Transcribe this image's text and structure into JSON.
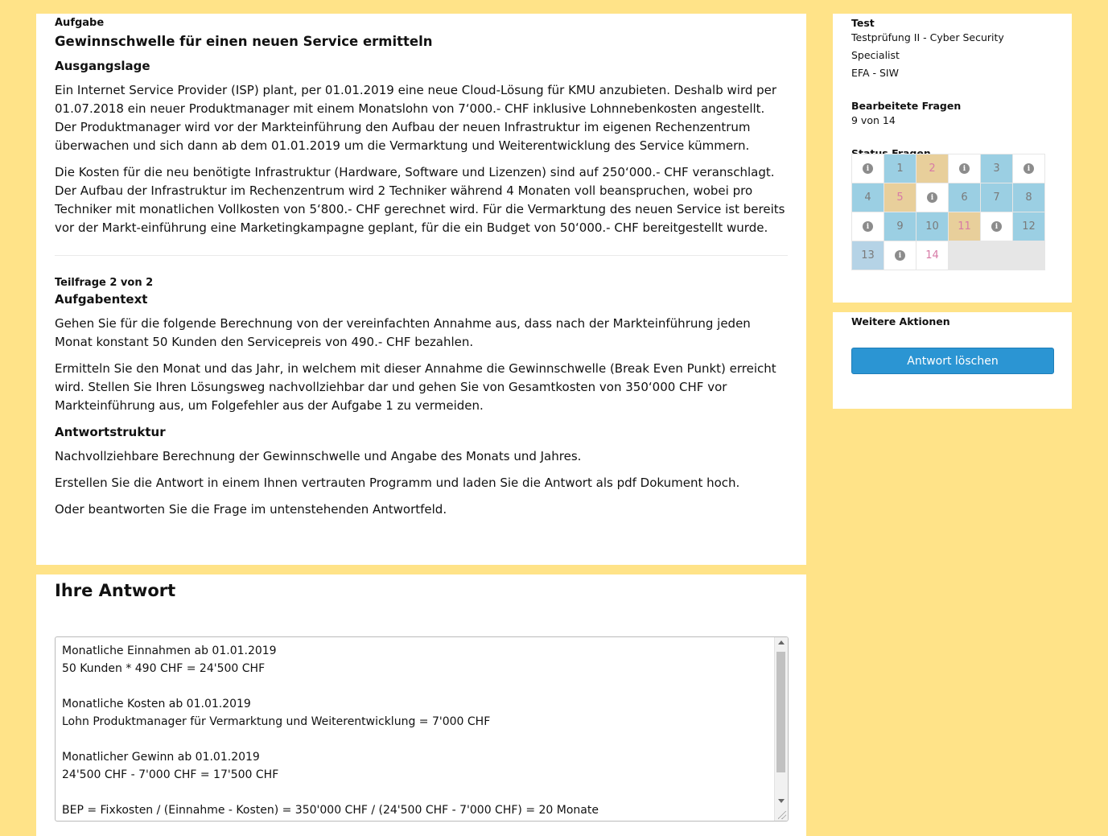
{
  "question": {
    "kicker": "Aufgabe",
    "title": "Gewinnschwelle für einen neuen Service ermitteln",
    "situation_heading": "Ausgangslage",
    "situation_p1": "Ein Internet Service Provider (ISP) plant, per 01.01.2019 eine neue Cloud-Lösung für KMU anzubieten. Deshalb wird per 01.07.2018 ein neuer Produktmanager mit einem Monatslohn von 7‘000.- CHF inklusive Lohnnebenkosten angestellt. Der Produktmanager wird vor der Markteinführung den Aufbau der neuen Infrastruktur im eigenen Rechenzentrum überwachen und sich dann ab dem 01.01.2019 um die Vermarktung und Weiterentwicklung des Service kümmern.",
    "situation_p2": "Die Kosten für die neu benötigte Infrastruktur (Hardware, Software und Lizenzen) sind auf 250‘000.- CHF veranschlagt. Der Aufbau der Infrastruktur im Rechenzentrum wird 2 Techniker während 4 Monaten voll beanspruchen, wobei pro Techniker mit monatlichen Vollkosten von 5‘800.- CHF gerechnet wird. Für die Vermarktung des neuen Service ist bereits vor der Markt-einführung eine Marketingkampagne geplant, für die ein Budget von 50‘000.- CHF bereitgestellt wurde.",
    "subquestion": "Teilfrage 2 von 2",
    "task_heading": "Aufgabentext",
    "task_p1": "Gehen Sie für die folgende Berechnung von der vereinfachten Annahme aus, dass nach der Markteinführung jeden Monat konstant 50 Kunden den Servicepreis von 490.- CHF bezahlen.",
    "task_p2": "Ermitteln Sie den Monat und das Jahr, in welchem mit dieser Annahme die Gewinnschwelle (Break Even Punkt) erreicht wird. Stellen Sie Ihren Lösungsweg nachvollziehbar dar und gehen Sie von Gesamtkosten von 350‘000 CHF vor Markteinführung aus, um Folgefehler aus der Aufgabe 1 zu vermeiden.",
    "structure_heading": "Antwortstruktur",
    "structure_p1": "Nachvollziehbare Berechnung der Gewinnschwelle und Angabe des Monats und Jahres.",
    "structure_p2": "Erstellen Sie die Antwort in einem Ihnen vertrauten Programm und laden Sie die Antwort als pdf Dokument hoch.",
    "structure_p3": "Oder beantworten Sie die Frage im untenstehenden Antwortfeld."
  },
  "answer": {
    "title": "Ihre Antwort",
    "text": "Monatliche Einnahmen ab 01.01.2019\n50 Kunden * 490 CHF = 24'500 CHF\n\nMonatliche Kosten ab 01.01.2019\nLohn Produktmanager für Vermarktung und Weiterentwicklung = 7'000 CHF\n\nMonatlicher Gewinn ab 01.01.2019\n24'500 CHF - 7'000 CHF = 17'500 CHF\n\nBEP = Fixkosten / (Einnahme - Kosten) = 350'000 CHF / (24'500 CHF - 7'000 CHF) = 20 Monate"
  },
  "sidebar": {
    "test_label": "Test",
    "test_name": "Testprüfung II - Cyber Security Specialist",
    "test_code": "EFA - SIW",
    "progress_label": "Bearbeitete Fragen",
    "progress_value": "9 von 14",
    "status_label": "Status Fragen",
    "status_cells": [
      {
        "label": "",
        "kind": "info"
      },
      {
        "label": "1",
        "kind": "blue"
      },
      {
        "label": "2",
        "kind": "tan"
      },
      {
        "label": "",
        "kind": "info"
      },
      {
        "label": "3",
        "kind": "blue"
      },
      {
        "label": "",
        "kind": "info"
      },
      {
        "label": "4",
        "kind": "blue"
      },
      {
        "label": "5",
        "kind": "tan"
      },
      {
        "label": "",
        "kind": "info"
      },
      {
        "label": "6",
        "kind": "blue"
      },
      {
        "label": "7",
        "kind": "blue"
      },
      {
        "label": "8",
        "kind": "blue"
      },
      {
        "label": "",
        "kind": "info"
      },
      {
        "label": "9",
        "kind": "blue"
      },
      {
        "label": "10",
        "kind": "blue"
      },
      {
        "label": "11",
        "kind": "tan"
      },
      {
        "label": "",
        "kind": "info"
      },
      {
        "label": "12",
        "kind": "blue"
      },
      {
        "label": "13",
        "kind": "lightblue"
      },
      {
        "label": "",
        "kind": "info"
      },
      {
        "label": "14",
        "kind": "pink"
      }
    ],
    "actions_label": "Weitere Aktionen",
    "delete_button": "Antwort löschen"
  },
  "colors": {
    "background": "#ffe388",
    "answered": "#9bcfe3",
    "flagged": "#e8cf9b",
    "button": "#2b95d3"
  }
}
